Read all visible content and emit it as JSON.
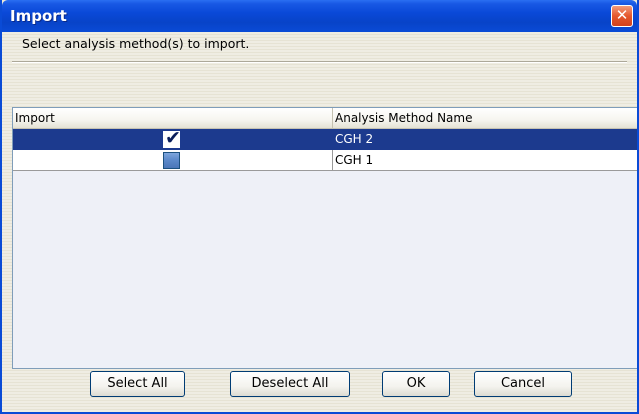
{
  "window": {
    "title": "Import",
    "close_glyph": "✕"
  },
  "instruction": "Select analysis method(s) to import.",
  "table": {
    "columns": [
      "Import",
      "Analysis Method Name"
    ],
    "rows": [
      {
        "checked": true,
        "name": "CGH 2",
        "selected": true
      },
      {
        "checked": false,
        "name": "CGH 1",
        "selected": false
      }
    ]
  },
  "buttons": {
    "select_all": "Select All",
    "deselect_all": "Deselect All",
    "ok": "OK",
    "cancel": "Cancel"
  },
  "colors": {
    "titlebar": "#0a4bd6",
    "selection": "#1c3a8e",
    "close": "#e5572c"
  },
  "icons": {
    "checkmark": "✔"
  }
}
